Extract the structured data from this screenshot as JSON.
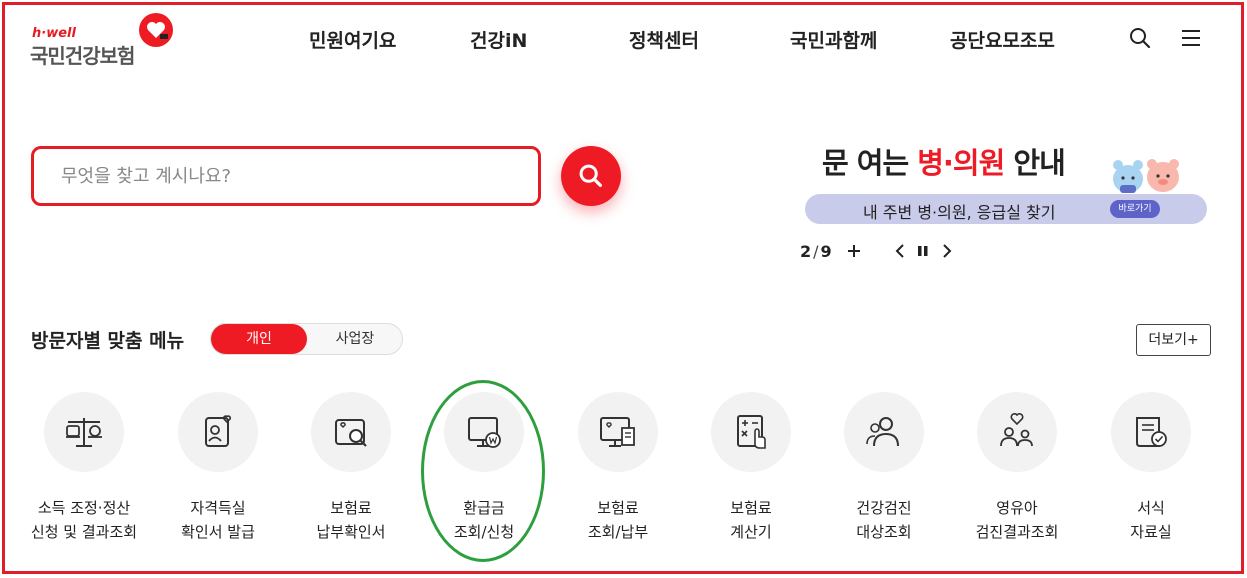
{
  "logo": {
    "small_text": "h·well",
    "main_text": "국민건강보험"
  },
  "nav": {
    "items": [
      {
        "label": "민원여기요"
      },
      {
        "label": "건강iN"
      },
      {
        "label": "정책센터"
      },
      {
        "label": "국민과함께"
      },
      {
        "label": "공단요모조모"
      }
    ]
  },
  "search": {
    "placeholder": "무엇을 찾고 계시나요?"
  },
  "banner": {
    "title_part1": "문 여는 ",
    "title_accent": "병·의원",
    "title_part2": " 안내",
    "pill_text": "내 주변 병·의원, 응급실 찾기",
    "go_label": "바로가기",
    "current": "2",
    "separator": "/",
    "total": "9",
    "plus_label": "+"
  },
  "menu": {
    "title": "방문자별 맞춤 메뉴",
    "tab_personal": "개인",
    "tab_business": "사업장",
    "more_label": "더보기+",
    "tiles": [
      {
        "line1": "소득 조정·정산",
        "line2": "신청 및 결과조회",
        "icon": "scale-icon"
      },
      {
        "line1": "자격득실",
        "line2": "확인서 발급",
        "icon": "id-card-heart-icon"
      },
      {
        "line1": "보험료",
        "line2": "납부확인서",
        "icon": "document-search-icon"
      },
      {
        "line1": "환급금",
        "line2": "조회/신청",
        "icon": "monitor-won-icon"
      },
      {
        "line1": "보험료",
        "line2": "조회/납부",
        "icon": "monitor-receipt-icon"
      },
      {
        "line1": "보험료",
        "line2": "계산기",
        "icon": "calculator-icon"
      },
      {
        "line1": "건강검진",
        "line2": "대상조회",
        "icon": "people-search-icon"
      },
      {
        "line1": "영유아",
        "line2": "검진결과조회",
        "icon": "family-heart-icon"
      },
      {
        "line1": "서식",
        "line2": "자료실",
        "icon": "form-check-icon"
      }
    ]
  },
  "colors": {
    "brand_red": "#ee1b24",
    "frame_red": "#e01e2a",
    "highlight_green": "#2e9f3e",
    "pill_purple": "#c9cbeb"
  }
}
